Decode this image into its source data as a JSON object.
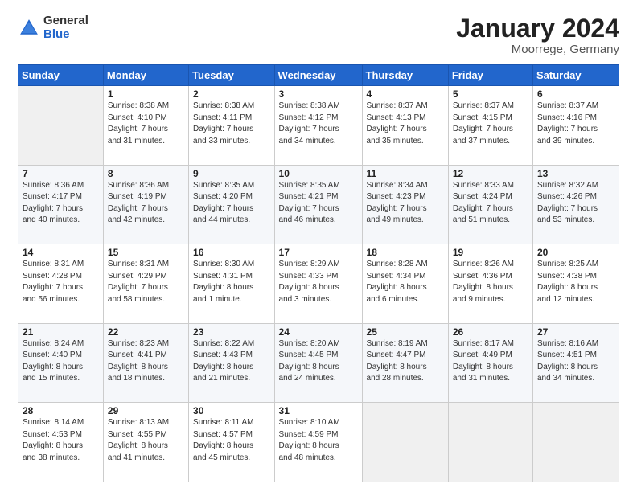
{
  "header": {
    "logo": {
      "general": "General",
      "blue": "Blue"
    },
    "title": "January 2024",
    "location": "Moorrege, Germany"
  },
  "weekdays": [
    "Sunday",
    "Monday",
    "Tuesday",
    "Wednesday",
    "Thursday",
    "Friday",
    "Saturday"
  ],
  "weeks": [
    [
      {
        "day": "",
        "info": ""
      },
      {
        "day": "1",
        "info": "Sunrise: 8:38 AM\nSunset: 4:10 PM\nDaylight: 7 hours\nand 31 minutes."
      },
      {
        "day": "2",
        "info": "Sunrise: 8:38 AM\nSunset: 4:11 PM\nDaylight: 7 hours\nand 33 minutes."
      },
      {
        "day": "3",
        "info": "Sunrise: 8:38 AM\nSunset: 4:12 PM\nDaylight: 7 hours\nand 34 minutes."
      },
      {
        "day": "4",
        "info": "Sunrise: 8:37 AM\nSunset: 4:13 PM\nDaylight: 7 hours\nand 35 minutes."
      },
      {
        "day": "5",
        "info": "Sunrise: 8:37 AM\nSunset: 4:15 PM\nDaylight: 7 hours\nand 37 minutes."
      },
      {
        "day": "6",
        "info": "Sunrise: 8:37 AM\nSunset: 4:16 PM\nDaylight: 7 hours\nand 39 minutes."
      }
    ],
    [
      {
        "day": "7",
        "info": "Sunrise: 8:36 AM\nSunset: 4:17 PM\nDaylight: 7 hours\nand 40 minutes."
      },
      {
        "day": "8",
        "info": "Sunrise: 8:36 AM\nSunset: 4:19 PM\nDaylight: 7 hours\nand 42 minutes."
      },
      {
        "day": "9",
        "info": "Sunrise: 8:35 AM\nSunset: 4:20 PM\nDaylight: 7 hours\nand 44 minutes."
      },
      {
        "day": "10",
        "info": "Sunrise: 8:35 AM\nSunset: 4:21 PM\nDaylight: 7 hours\nand 46 minutes."
      },
      {
        "day": "11",
        "info": "Sunrise: 8:34 AM\nSunset: 4:23 PM\nDaylight: 7 hours\nand 49 minutes."
      },
      {
        "day": "12",
        "info": "Sunrise: 8:33 AM\nSunset: 4:24 PM\nDaylight: 7 hours\nand 51 minutes."
      },
      {
        "day": "13",
        "info": "Sunrise: 8:32 AM\nSunset: 4:26 PM\nDaylight: 7 hours\nand 53 minutes."
      }
    ],
    [
      {
        "day": "14",
        "info": "Sunrise: 8:31 AM\nSunset: 4:28 PM\nDaylight: 7 hours\nand 56 minutes."
      },
      {
        "day": "15",
        "info": "Sunrise: 8:31 AM\nSunset: 4:29 PM\nDaylight: 7 hours\nand 58 minutes."
      },
      {
        "day": "16",
        "info": "Sunrise: 8:30 AM\nSunset: 4:31 PM\nDaylight: 8 hours\nand 1 minute."
      },
      {
        "day": "17",
        "info": "Sunrise: 8:29 AM\nSunset: 4:33 PM\nDaylight: 8 hours\nand 3 minutes."
      },
      {
        "day": "18",
        "info": "Sunrise: 8:28 AM\nSunset: 4:34 PM\nDaylight: 8 hours\nand 6 minutes."
      },
      {
        "day": "19",
        "info": "Sunrise: 8:26 AM\nSunset: 4:36 PM\nDaylight: 8 hours\nand 9 minutes."
      },
      {
        "day": "20",
        "info": "Sunrise: 8:25 AM\nSunset: 4:38 PM\nDaylight: 8 hours\nand 12 minutes."
      }
    ],
    [
      {
        "day": "21",
        "info": "Sunrise: 8:24 AM\nSunset: 4:40 PM\nDaylight: 8 hours\nand 15 minutes."
      },
      {
        "day": "22",
        "info": "Sunrise: 8:23 AM\nSunset: 4:41 PM\nDaylight: 8 hours\nand 18 minutes."
      },
      {
        "day": "23",
        "info": "Sunrise: 8:22 AM\nSunset: 4:43 PM\nDaylight: 8 hours\nand 21 minutes."
      },
      {
        "day": "24",
        "info": "Sunrise: 8:20 AM\nSunset: 4:45 PM\nDaylight: 8 hours\nand 24 minutes."
      },
      {
        "day": "25",
        "info": "Sunrise: 8:19 AM\nSunset: 4:47 PM\nDaylight: 8 hours\nand 28 minutes."
      },
      {
        "day": "26",
        "info": "Sunrise: 8:17 AM\nSunset: 4:49 PM\nDaylight: 8 hours\nand 31 minutes."
      },
      {
        "day": "27",
        "info": "Sunrise: 8:16 AM\nSunset: 4:51 PM\nDaylight: 8 hours\nand 34 minutes."
      }
    ],
    [
      {
        "day": "28",
        "info": "Sunrise: 8:14 AM\nSunset: 4:53 PM\nDaylight: 8 hours\nand 38 minutes."
      },
      {
        "day": "29",
        "info": "Sunrise: 8:13 AM\nSunset: 4:55 PM\nDaylight: 8 hours\nand 41 minutes."
      },
      {
        "day": "30",
        "info": "Sunrise: 8:11 AM\nSunset: 4:57 PM\nDaylight: 8 hours\nand 45 minutes."
      },
      {
        "day": "31",
        "info": "Sunrise: 8:10 AM\nSunset: 4:59 PM\nDaylight: 8 hours\nand 48 minutes."
      },
      {
        "day": "",
        "info": ""
      },
      {
        "day": "",
        "info": ""
      },
      {
        "day": "",
        "info": ""
      }
    ]
  ]
}
